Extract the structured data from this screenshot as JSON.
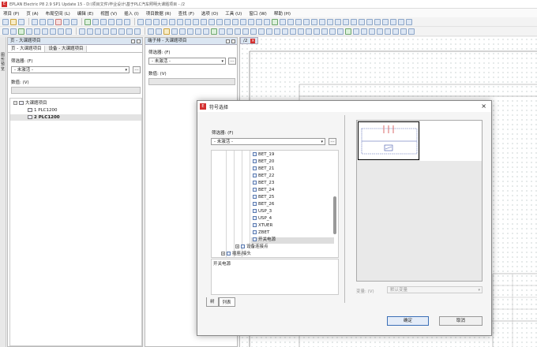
{
  "window": {
    "title": "EPLAN Electric P8 2.9 SP1 Update 15 - D:\\项目文件\\毕业设计\\基于PLC汽车照明大课题项目 - /2"
  },
  "menu": [
    "项目 (P)",
    "页 (A)",
    "布局空间 (L)",
    "编辑 (E)",
    "视图 (V)",
    "插入 (I)",
    "项目数据 (R)",
    "查找 (F)",
    "选项 (O)",
    "工具 (U)",
    "窗口 (W)",
    "帮助 (H)"
  ],
  "sidestrip": {
    "label": "图形预览"
  },
  "page_panel": {
    "title": "页 - 大课题项目",
    "tabs": [
      "页 - 大课题项目",
      "设备 - 大课题项目"
    ],
    "filter_label": "筛选器: (F)",
    "filter_value": "- 未激活 -",
    "value_label": "数值: (V)",
    "tree": [
      {
        "label": "大课题项目",
        "level": 0
      },
      {
        "label": "1 PLC1200",
        "level": 1
      },
      {
        "label": "2 PLC1200",
        "level": 1,
        "selected": true
      }
    ]
  },
  "terminal_panel": {
    "title": "端子排 - 大课题项目",
    "filter_label": "筛选器: (F)",
    "filter_value": "- 未激活 -",
    "value_label": "数值: (V)"
  },
  "canvas": {
    "tab_label": "/2"
  },
  "dialog": {
    "title": "符号选择",
    "filter_label": "筛选器: (F)",
    "filter_value": "- 未激活 -",
    "items": [
      "BET_19",
      "BET_20",
      "BET_21",
      "BET_22",
      "BET_23",
      "BET_24",
      "BET_25",
      "BET_26",
      "USP_3",
      "USP_4",
      "XTUER",
      "ZBET",
      "开关电源"
    ],
    "selected_item": "开关电源",
    "group_item": "设备连接点",
    "cut_item": "插座/接头",
    "selection_text": "开关电源",
    "tabs": [
      "树",
      "列表"
    ],
    "variant_label": "变量: (V)",
    "variant_value": "默认变量",
    "ok_label": "确定",
    "cancel_label": "取消"
  }
}
